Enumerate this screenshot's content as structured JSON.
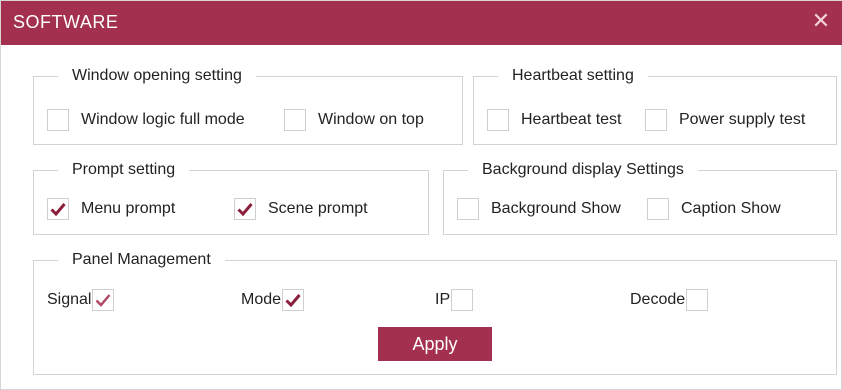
{
  "window": {
    "title": "SOFTWARE",
    "close_icon": "close-icon"
  },
  "colors": {
    "accent": "#a3304e",
    "border": "#d3d3d3"
  },
  "window_opening": {
    "legend": "Window opening setting",
    "options": [
      {
        "label": "Window logic full mode",
        "checked": false
      },
      {
        "label": "Window on top",
        "checked": false
      }
    ]
  },
  "heartbeat": {
    "legend": "Heartbeat setting",
    "options": [
      {
        "label": "Heartbeat test",
        "checked": false
      },
      {
        "label": "Power supply test",
        "checked": false
      }
    ]
  },
  "prompt": {
    "legend": "Prompt setting",
    "options": [
      {
        "label": "Menu prompt",
        "checked": true
      },
      {
        "label": "Scene prompt",
        "checked": true
      }
    ]
  },
  "background": {
    "legend": "Background display Settings",
    "options": [
      {
        "label": "Background Show",
        "checked": false
      },
      {
        "label": "Caption Show",
        "checked": false
      }
    ]
  },
  "panel": {
    "legend": "Panel Management",
    "options": [
      {
        "label": "Signal",
        "checked": true
      },
      {
        "label": "Mode",
        "checked": true
      },
      {
        "label": "IP",
        "checked": false
      },
      {
        "label": "Decode",
        "checked": false
      }
    ],
    "apply_label": "Apply"
  }
}
